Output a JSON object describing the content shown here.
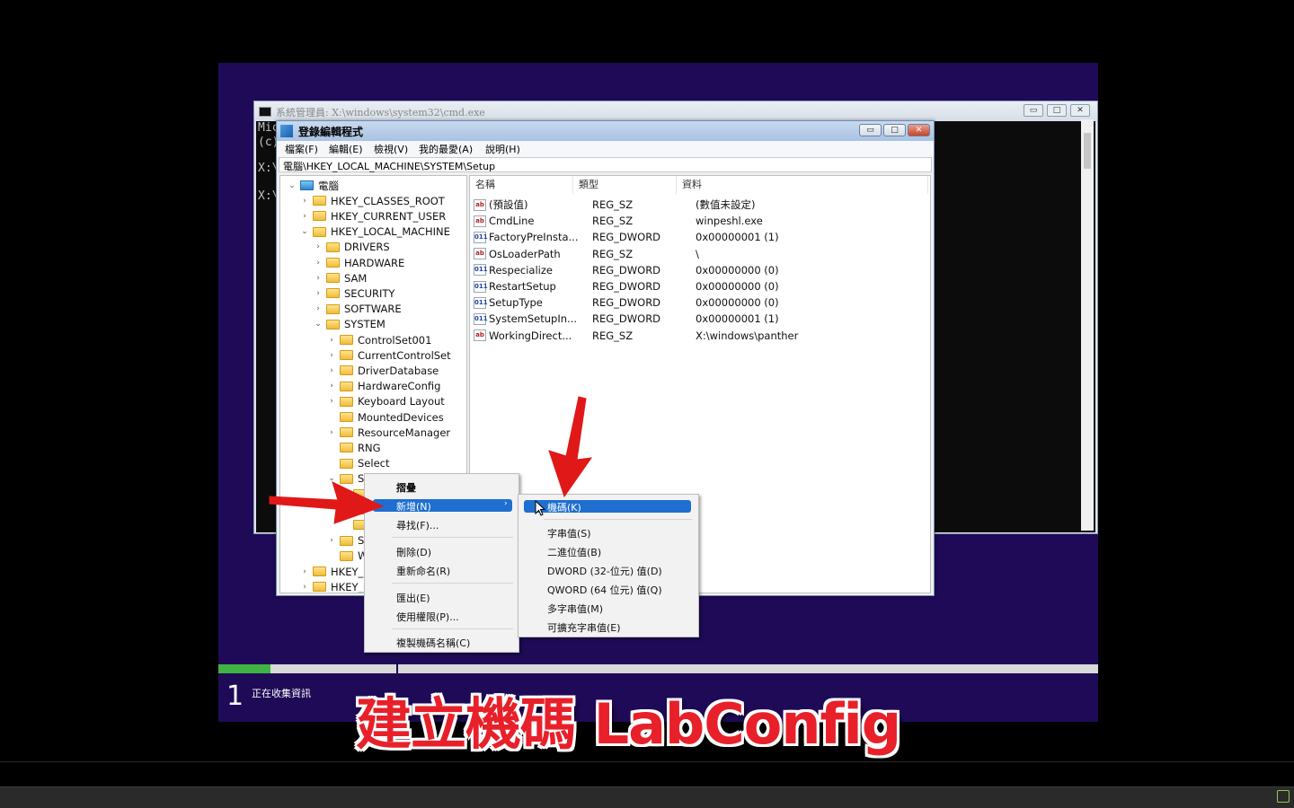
{
  "cmd": {
    "title": "系統管理員: X:\\windows\\system32\\cmd.exe",
    "lines": [
      "Mic",
      "(c)",
      "X:\\",
      "X:\\"
    ],
    "buttons": [
      "▭",
      "□",
      "✕"
    ]
  },
  "regedit": {
    "title": "登錄編輯程式",
    "menu": [
      "檔案(F)",
      "編輯(E)",
      "檢視(V)",
      "我的最愛(A)",
      "說明(H)"
    ],
    "address": "電腦\\HKEY_LOCAL_MACHINE\\SYSTEM\\Setup",
    "tree": [
      {
        "label": "電腦",
        "arrow": "⌄",
        "icon": "computer"
      },
      {
        "label": "HKEY_CLASSES_ROOT",
        "arrow": "›",
        "icon": "folder"
      },
      {
        "label": "HKEY_CURRENT_USER",
        "arrow": "›",
        "icon": "folder"
      },
      {
        "label": "HKEY_LOCAL_MACHINE",
        "arrow": "⌄",
        "icon": "folder"
      },
      {
        "label": "DRIVERS",
        "arrow": "›",
        "icon": "folder"
      },
      {
        "label": "HARDWARE",
        "arrow": "›",
        "icon": "folder"
      },
      {
        "label": "SAM",
        "arrow": "›",
        "icon": "folder"
      },
      {
        "label": "SECURITY",
        "arrow": "›",
        "icon": "folder"
      },
      {
        "label": "SOFTWARE",
        "arrow": "›",
        "icon": "folder"
      },
      {
        "label": "SYSTEM",
        "arrow": "⌄",
        "icon": "folder"
      },
      {
        "label": "ControlSet001",
        "arrow": "›",
        "icon": "folder"
      },
      {
        "label": "CurrentControlSet",
        "arrow": "›",
        "icon": "folder"
      },
      {
        "label": "DriverDatabase",
        "arrow": "›",
        "icon": "folder"
      },
      {
        "label": "HardwareConfig",
        "arrow": "›",
        "icon": "folder"
      },
      {
        "label": "Keyboard Layout",
        "arrow": "›",
        "icon": "folder"
      },
      {
        "label": "MountedDevices",
        "arrow": "",
        "icon": "folder"
      },
      {
        "label": "ResourceManager",
        "arrow": "›",
        "icon": "folder"
      },
      {
        "label": "RNG",
        "arrow": "",
        "icon": "folder"
      },
      {
        "label": "Select",
        "arrow": "",
        "icon": "folder"
      },
      {
        "label": "Se",
        "arrow": "⌄",
        "icon": "folder"
      },
      {
        "label": "",
        "arrow": "",
        "icon": "folder"
      },
      {
        "label": "",
        "arrow": "",
        "icon": "folder"
      },
      {
        "label": "",
        "arrow": "",
        "icon": "folder"
      },
      {
        "label": "Sc",
        "arrow": "›",
        "icon": "folder"
      },
      {
        "label": "W",
        "arrow": "",
        "icon": "folder"
      },
      {
        "label": "HKEY_U",
        "arrow": "›",
        "icon": "folder"
      },
      {
        "label": "HKEY_C",
        "arrow": "›",
        "icon": "folder"
      }
    ],
    "columns": [
      "名稱",
      "類型",
      "資料"
    ],
    "values": [
      {
        "icon": "ab",
        "name": "(預設值)",
        "type": "REG_SZ",
        "data": "(數值未設定)"
      },
      {
        "icon": "ab",
        "name": "CmdLine",
        "type": "REG_SZ",
        "data": "winpeshl.exe"
      },
      {
        "icon": "bin",
        "name": "FactoryPreInsta...",
        "type": "REG_DWORD",
        "data": "0x00000001 (1)"
      },
      {
        "icon": "ab",
        "name": "OsLoaderPath",
        "type": "REG_SZ",
        "data": "\\"
      },
      {
        "icon": "bin",
        "name": "Respecialize",
        "type": "REG_DWORD",
        "data": "0x00000000 (0)"
      },
      {
        "icon": "bin",
        "name": "RestartSetup",
        "type": "REG_DWORD",
        "data": "0x00000000 (0)"
      },
      {
        "icon": "bin",
        "name": "SetupType",
        "type": "REG_DWORD",
        "data": "0x00000000 (0)"
      },
      {
        "icon": "bin",
        "name": "SystemSetupIn...",
        "type": "REG_DWORD",
        "data": "0x00000001 (1)"
      },
      {
        "icon": "ab",
        "name": "WorkingDirect...",
        "type": "REG_SZ",
        "data": "X:\\windows\\panther"
      }
    ]
  },
  "context_menu": {
    "items": [
      "摺疊",
      "新增(N)",
      "尋找(F)...",
      "刪除(D)",
      "重新命名(R)",
      "匯出(E)",
      "使用權限(P)...",
      "複製機碼名稱(C)"
    ]
  },
  "submenu": {
    "items": [
      "機碼(K)",
      "字串值(S)",
      "二進位值(B)",
      "DWORD (32-位元) 值(D)",
      "QWORD (64 位元) 值(Q)",
      "多字串值(M)",
      "可擴充字串值(E)"
    ]
  },
  "setup": {
    "step_number": "1",
    "step_label": "正在收集資訊",
    "progress": 0.06
  },
  "caption": "建立機碼 LabConfig",
  "colors": {
    "setup_bg": "#1f0a57",
    "highlight": "#1e6fd0",
    "arrow": "#e01818",
    "caption": "#e8202a",
    "progress": "#41b342"
  }
}
